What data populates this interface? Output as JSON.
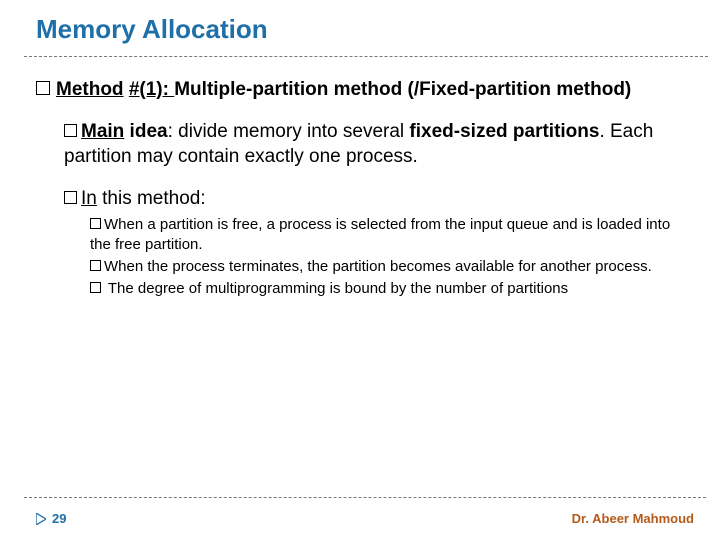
{
  "title": "Memory Allocation",
  "method": {
    "label_underlined_1": "Method",
    "label_underlined_2": "#(1): ",
    "rest_bold": "Multiple-partition method (/Fixed-partition method)"
  },
  "main_idea": {
    "label_underlined": "Main",
    "label_bold_rest": " idea",
    "colon": ": divide memory into several ",
    "bold1": "fixed-sized partitions",
    "after": ". Each partition may contain exactly one process."
  },
  "in_this": {
    "label_underlined": "In",
    "rest": " this method:"
  },
  "sub": {
    "a": "When a partition is free, a process is selected from the input queue and is loaded into the free partition.",
    "b": "When the process terminates, the partition becomes available for another process.",
    "c": " The degree of multiprogramming is bound by the number of partitions"
  },
  "page_number": "29",
  "author": "Dr. Abeer Mahmoud"
}
